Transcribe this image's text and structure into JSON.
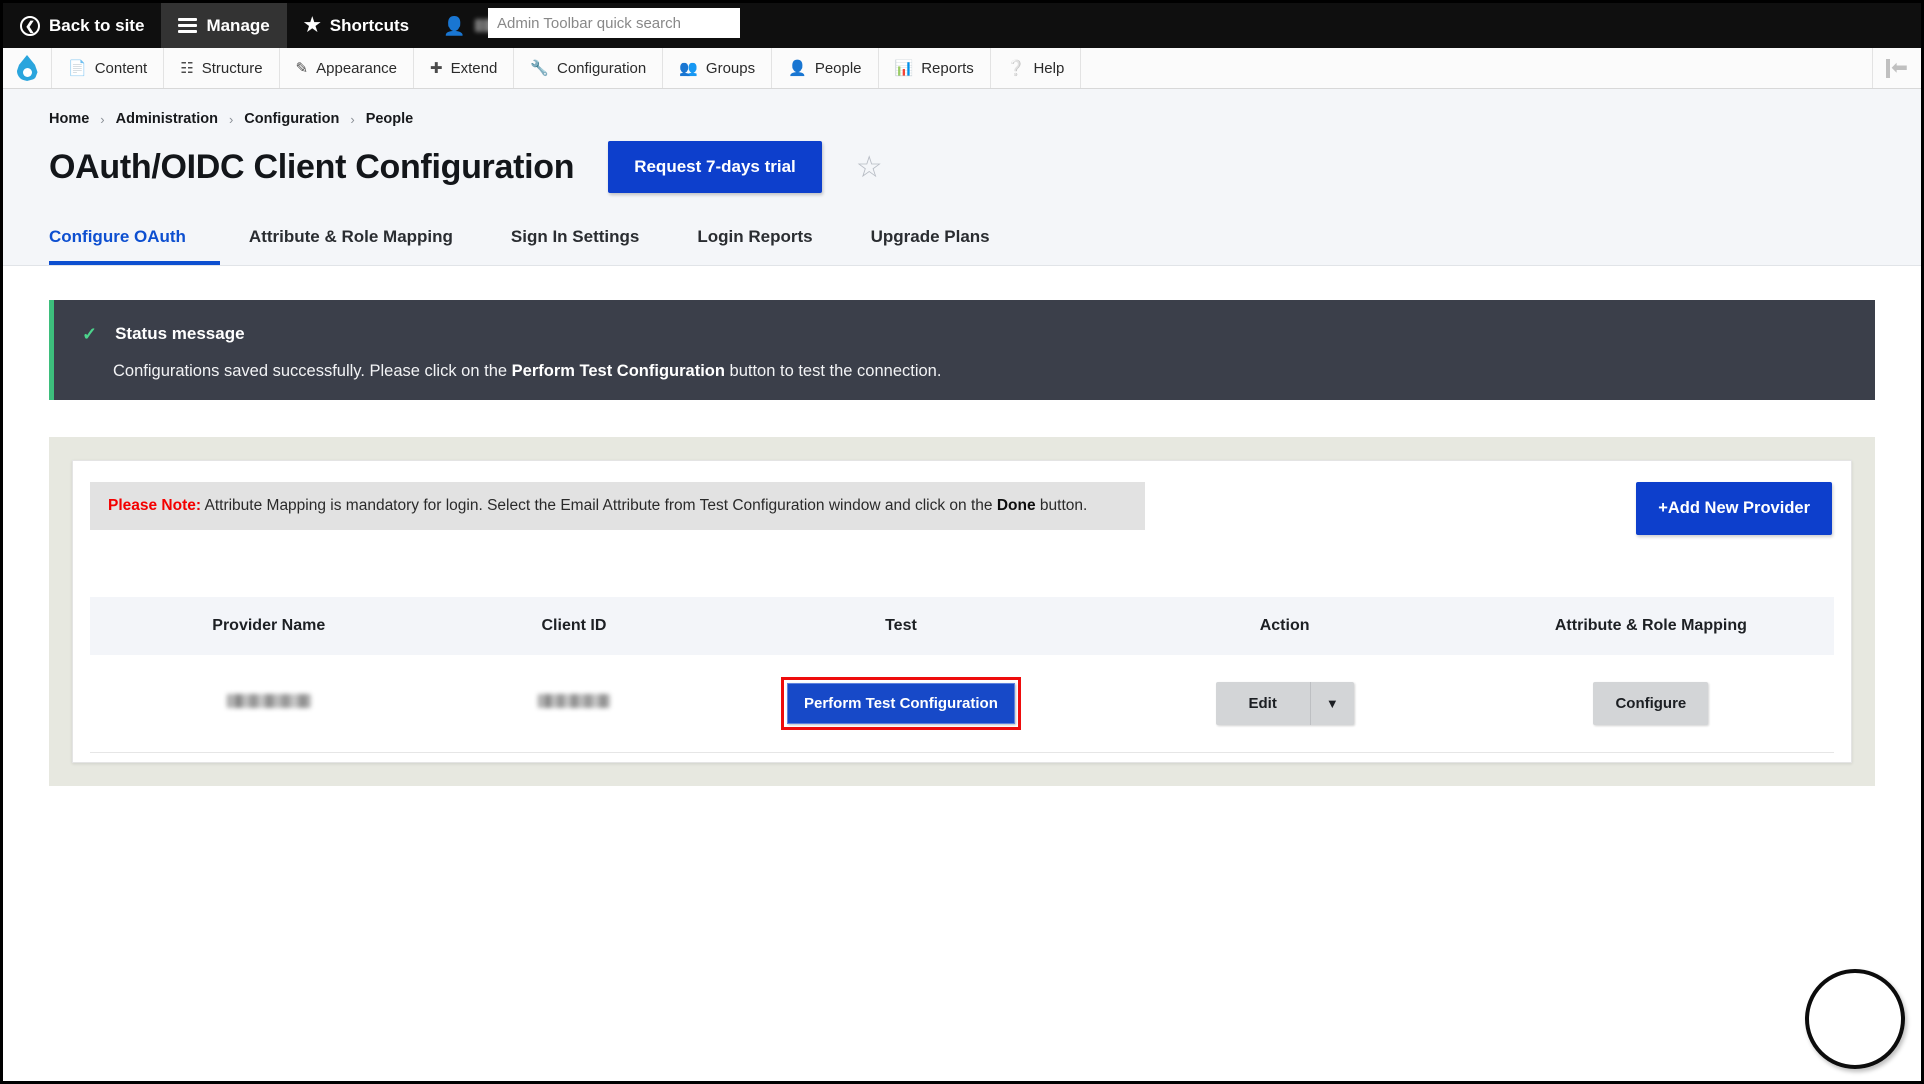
{
  "admin_toolbar": {
    "back_to_site": "Back to site",
    "manage": "Manage",
    "shortcuts": "Shortcuts",
    "username_redacted": "",
    "search_placeholder": "Admin Toolbar quick search"
  },
  "menu_bar": {
    "items": [
      {
        "label": "Content",
        "icon": "document-icon"
      },
      {
        "label": "Structure",
        "icon": "sitemap-icon"
      },
      {
        "label": "Appearance",
        "icon": "paintbrush-icon"
      },
      {
        "label": "Extend",
        "icon": "puzzle-icon"
      },
      {
        "label": "Configuration",
        "icon": "wrench-icon"
      },
      {
        "label": "Groups",
        "icon": "group-icon"
      },
      {
        "label": "People",
        "icon": "people-icon"
      },
      {
        "label": "Reports",
        "icon": "bar-chart-icon"
      },
      {
        "label": "Help",
        "icon": "question-circle-icon"
      }
    ]
  },
  "breadcrumb": [
    "Home",
    "Administration",
    "Configuration",
    "People"
  ],
  "header": {
    "title": "OAuth/OIDC Client Configuration",
    "trial_button": "Request 7-days trial",
    "favorite_icon": "star-outline-icon"
  },
  "tabs": [
    {
      "label": "Configure OAuth",
      "active": true
    },
    {
      "label": "Attribute & Role Mapping",
      "active": false
    },
    {
      "label": "Sign In Settings",
      "active": false
    },
    {
      "label": "Login Reports",
      "active": false
    },
    {
      "label": "Upgrade Plans",
      "active": false
    }
  ],
  "status_message": {
    "icon": "check-icon",
    "title": "Status message",
    "text_before": "Configurations saved successfully. Please click on the ",
    "text_bold": "Perform Test Configuration",
    "text_after": " button to test the connection."
  },
  "note": {
    "label": "Please Note:",
    "text_before": " Attribute Mapping is mandatory for login. Select the Email Attribute from Test Configuration window and click on the ",
    "text_bold": "Done",
    "text_after": " button."
  },
  "add_provider_button": "+Add New Provider",
  "table": {
    "headers": [
      "Provider Name",
      "Client ID",
      "Test",
      "Action",
      "Attribute & Role Mapping"
    ],
    "rows": [
      {
        "provider_name": "",
        "client_id": "",
        "test_button": "Perform Test Configuration",
        "action_button": "Edit",
        "action_caret": "chevron-down-icon",
        "mapping_button": "Configure"
      }
    ]
  },
  "colors": {
    "primary_blue": "#0d3fcc",
    "tab_active_blue": "#0d4fd0",
    "status_bg": "#3b3f4a",
    "status_accent_green": "#3dbe7c",
    "note_red": "#f40000",
    "highlight_red": "#ee0c0c",
    "panel_beige": "#e7e8e0",
    "drupal_blue": "#2aa5dd"
  },
  "annotation": {
    "cursor_highlight": "circle-highlight"
  }
}
